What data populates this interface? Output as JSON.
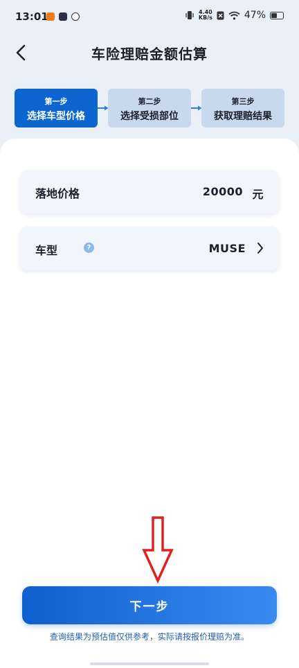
{
  "status_bar": {
    "time": "13:01",
    "net_speed_value": "4.40",
    "net_speed_unit": "KB/s",
    "battery_text": "47%"
  },
  "header": {
    "title": "车险理赔金额估算"
  },
  "steps": [
    {
      "step_label": "第一步",
      "title": "选择车型价格",
      "state": "active"
    },
    {
      "step_label": "第二步",
      "title": "选择受损部位",
      "state": "inactive"
    },
    {
      "step_label": "第三步",
      "title": "获取理赔结果",
      "state": "inactive"
    }
  ],
  "form": {
    "price_label": "落地价格",
    "price_value": "20000",
    "price_unit": "元",
    "model_label": "车型",
    "help_glyph": "?",
    "model_value": "MUSE"
  },
  "footer": {
    "next_label": "下一步",
    "disclaimer": "查询结果为预估值仅供参考，实际请按报价理赔为准。"
  },
  "colors": {
    "accent": "#0d66d0",
    "step_inactive": "#c8d9ee",
    "annotation": "#e0201f"
  }
}
